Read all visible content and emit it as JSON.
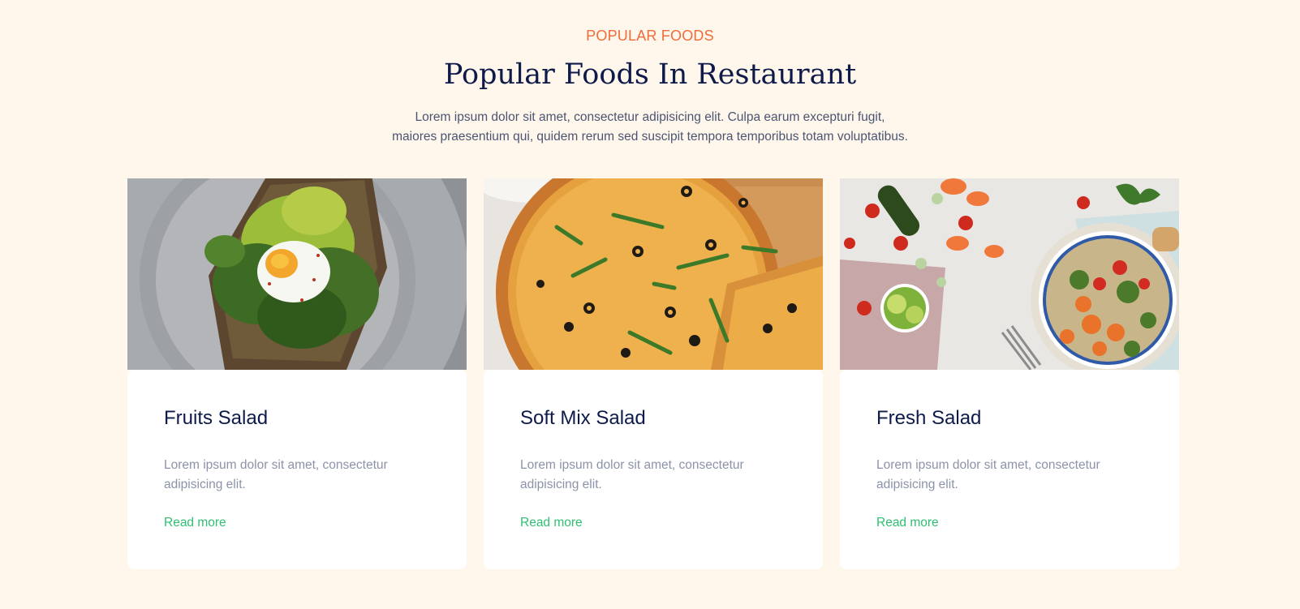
{
  "section": {
    "eyebrow": "POPULAR FOODS",
    "title": "Popular Foods In Restaurant",
    "lead_line1": "Lorem ipsum dolor sit amet, consectetur adipisicing elit. Culpa earum excepturi fugit,",
    "lead_line2": "maiores praesentium qui, quidem rerum sed suscipit tempora temporibus totam voluptatibus."
  },
  "cards": [
    {
      "title": "Fruits Salad",
      "description": "Lorem ipsum dolor sit amet, consectetur adipisicing elit.",
      "link": "Read more"
    },
    {
      "title": "Soft Mix Salad",
      "description": "Lorem ipsum dolor sit amet, consectetur adipisicing elit.",
      "link": "Read more"
    },
    {
      "title": "Fresh Salad",
      "description": "Lorem ipsum dolor sit amet, consectetur adipisicing elit.",
      "link": "Read more"
    }
  ],
  "colors": {
    "background": "#fff7eb",
    "accent": "#f26b3a",
    "heading": "#0d1a4a",
    "link": "#2fbf71"
  }
}
